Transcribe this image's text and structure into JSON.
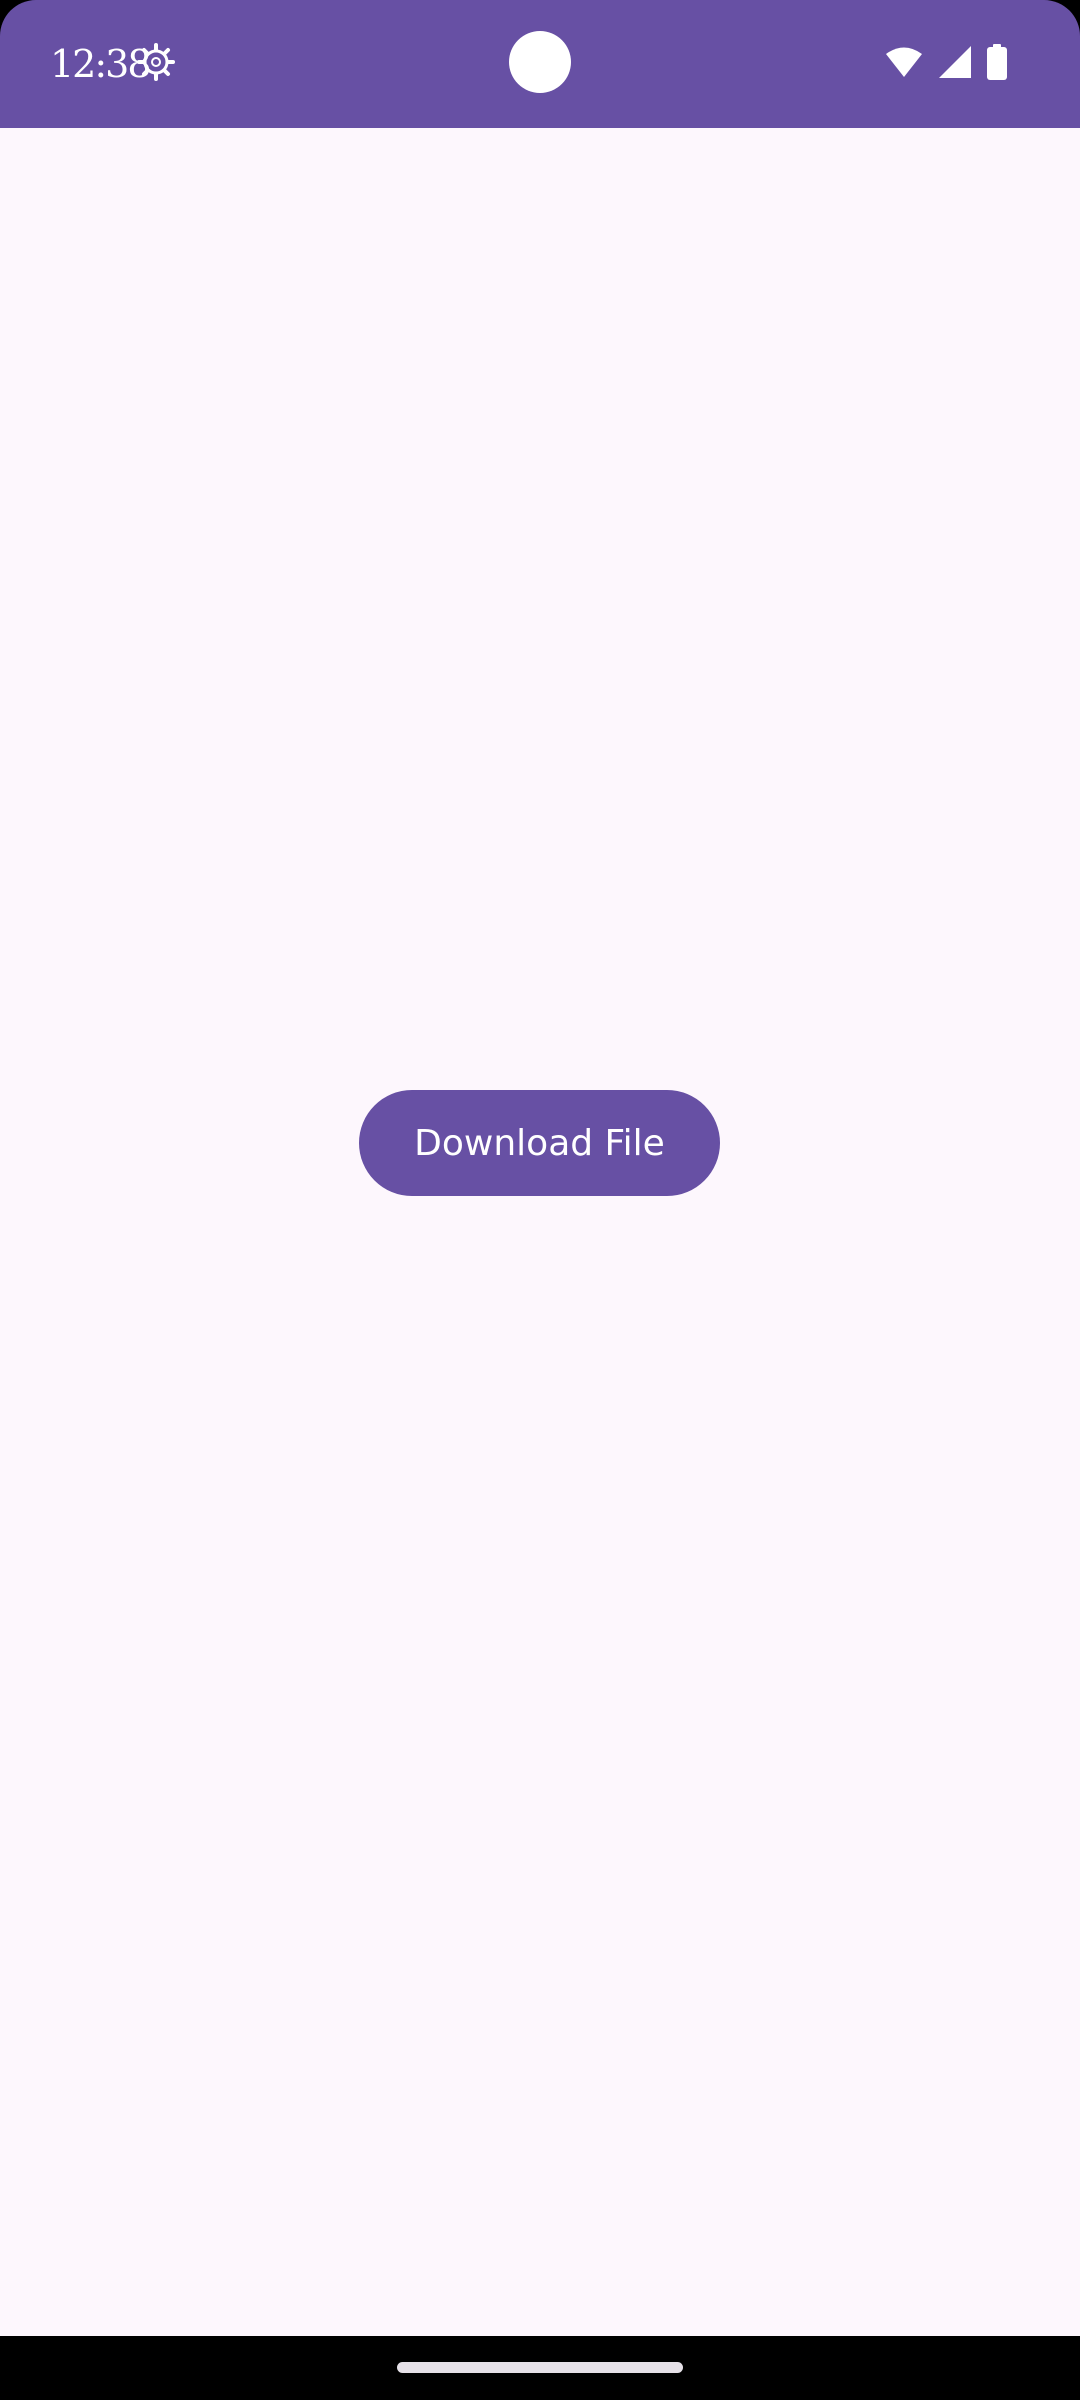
{
  "status_bar": {
    "time": "12:38",
    "background_color": "#6750A4",
    "icons": [
      "settings-gear-icon",
      "wifi-icon",
      "cellular-signal-icon",
      "battery-icon"
    ]
  },
  "main": {
    "background_color": "#FDF7FD",
    "download_button_label": "Download File",
    "button_color": "#6750A4"
  },
  "navigation": {
    "gesture_handle": "home-handle"
  }
}
